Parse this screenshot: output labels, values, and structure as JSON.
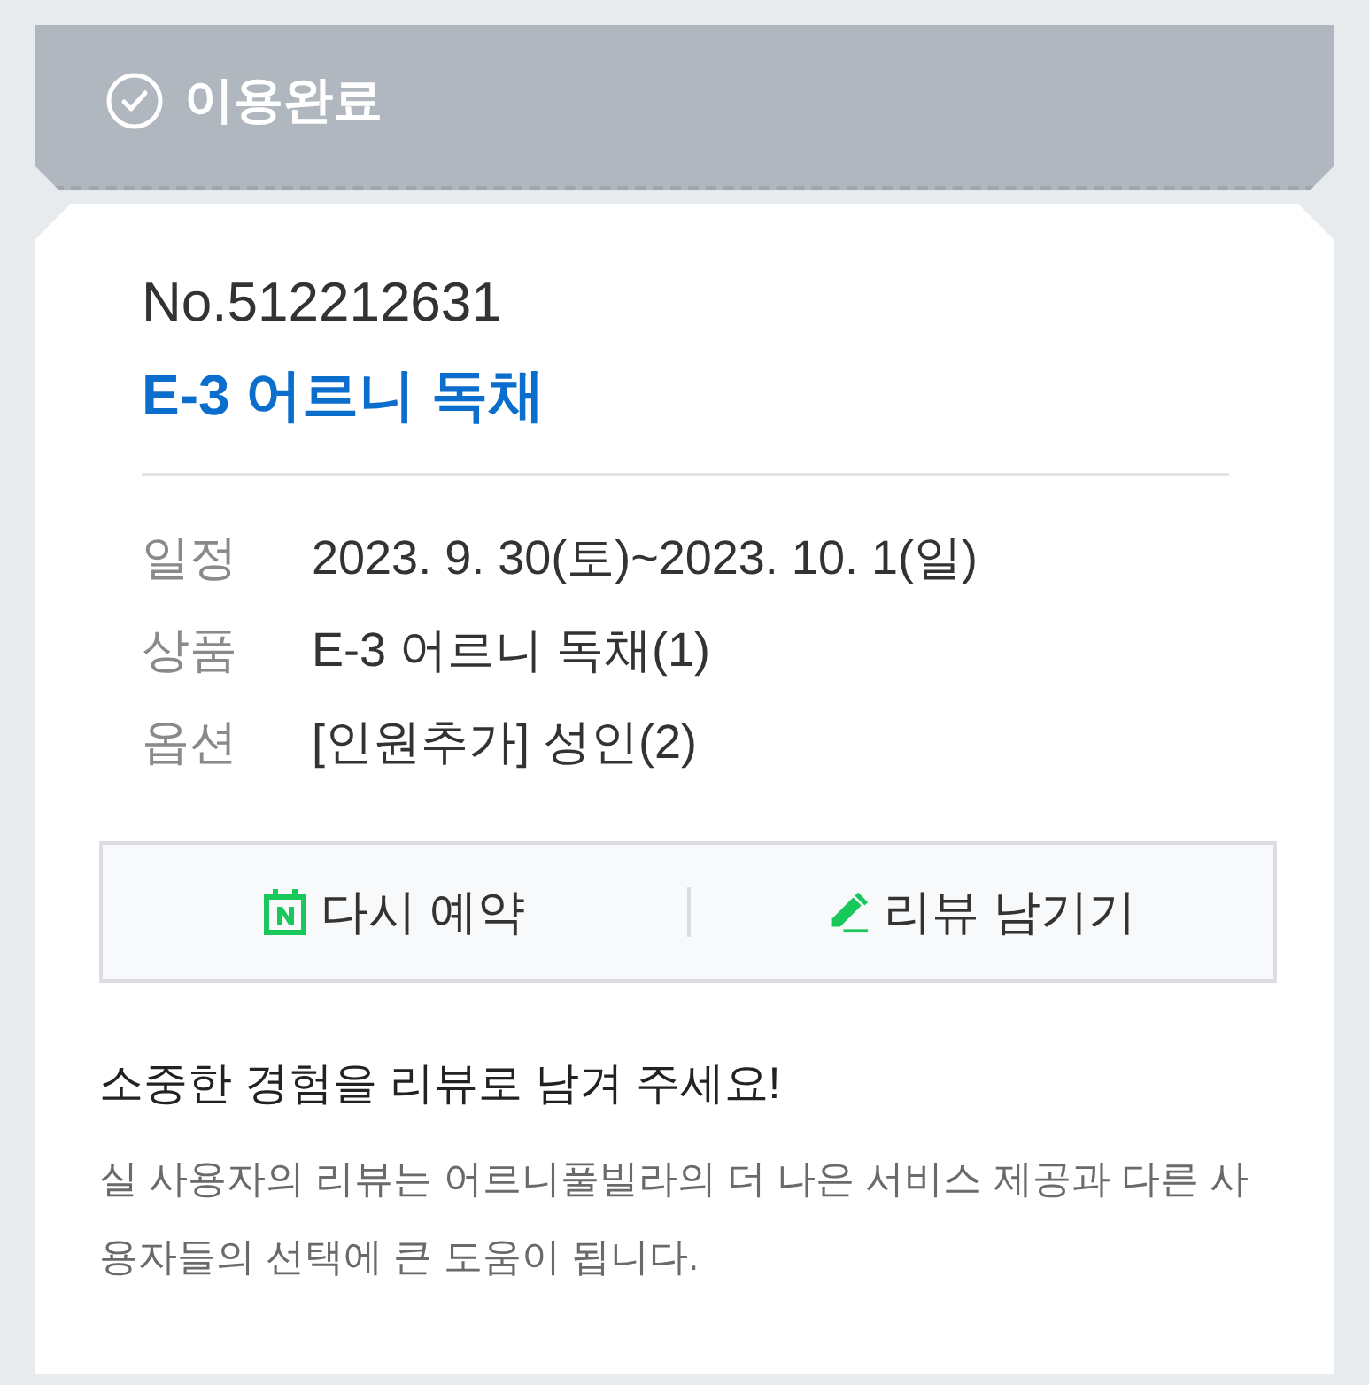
{
  "status": {
    "label": "이용완료"
  },
  "booking": {
    "number": "No.512212631",
    "title": "E-3 어르니 독채"
  },
  "details": [
    {
      "label": "일정",
      "value": "2023. 9. 30(토)~2023. 10. 1(일)"
    },
    {
      "label": "상품",
      "value": "E-3 어르니 독채(1)"
    },
    {
      "label": "옵션",
      "value": "[인원추가] 성인(2)"
    }
  ],
  "actions": [
    {
      "kind": "rebook",
      "label": "다시 예약"
    },
    {
      "kind": "review",
      "label": "리뷰 남기기"
    }
  ],
  "review_prompt": {
    "heading": "소중한 경험을 리뷰로 남겨 주세요!",
    "text": "실 사용자의 리뷰는 어르니풀빌라의 더 나은 서비스 제공과 다른 사용자들의 선택에 큰 도움이 됩니다."
  }
}
